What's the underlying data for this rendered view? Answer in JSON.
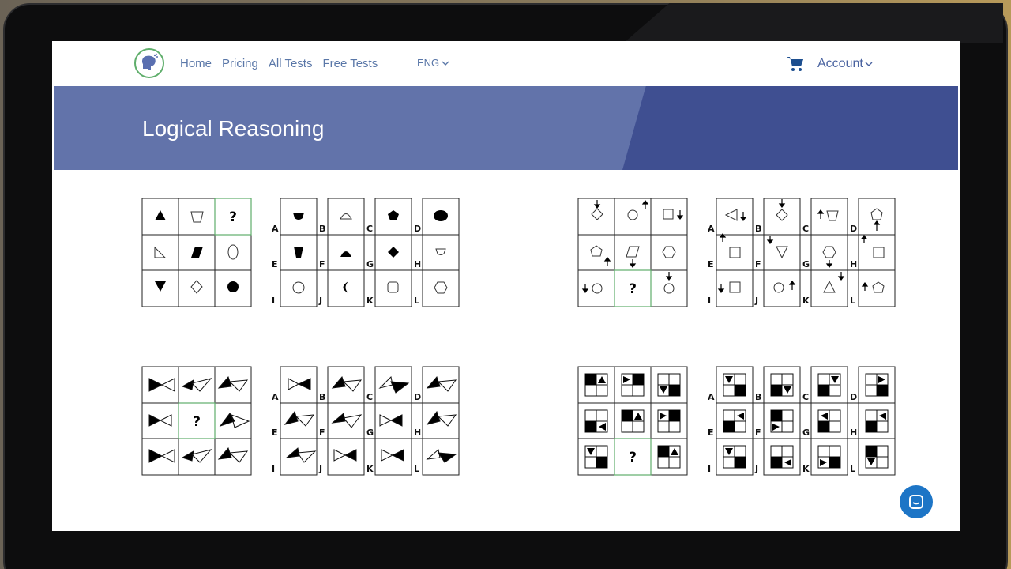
{
  "nav": {
    "items": [
      "Home",
      "Pricing",
      "All Tests",
      "Free Tests"
    ],
    "language": "ENG",
    "account": "Account"
  },
  "banner": {
    "title": "Logical Reasoning"
  },
  "puzzles": {
    "question_mark": "?",
    "option_letters": [
      "A",
      "B",
      "C",
      "D",
      "E",
      "F",
      "G",
      "H",
      "I",
      "J",
      "K",
      "L"
    ]
  },
  "colors": {
    "banner_light": "#6273aa",
    "banner_dark": "#3f4f91",
    "nav_text": "#5a77a8",
    "highlight_green": "#5fae6b",
    "intercom_blue": "#1d75c6"
  },
  "icons": {
    "cart": "cart-icon",
    "chevron": "chevron-down-icon",
    "logo": "brain-head-logo",
    "chat": "chat-icon"
  }
}
